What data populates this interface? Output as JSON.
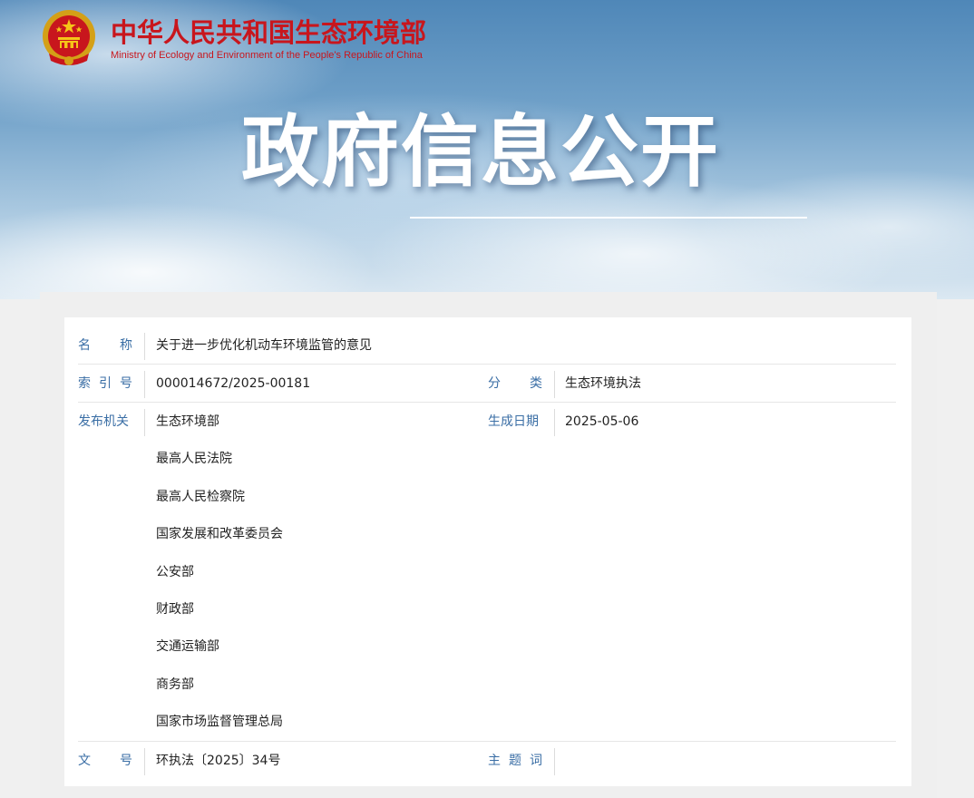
{
  "header": {
    "org_name_cn": "中华人民共和国生态环境部",
    "org_name_en": "Ministry of Ecology and Environment of the People's Republic of China",
    "emblem_icon": "national-emblem-icon",
    "page_title": "政府信息公开"
  },
  "info": {
    "name_label": [
      "名",
      "称"
    ],
    "name_value": "关于进一步优化机动车环境监管的意见",
    "index_label": [
      "索",
      "引",
      "号"
    ],
    "index_value": "000014672/2025-00181",
    "category_label": [
      "分",
      "类"
    ],
    "category_value": "生态环境执法",
    "issuer_label": "发布机关",
    "issuers": [
      "生态环境部",
      "最高人民法院",
      "最高人民检察院",
      "国家发展和改革委员会",
      "公安部",
      "财政部",
      "交通运输部",
      "商务部",
      "国家市场监督管理总局"
    ],
    "date_label": "生成日期",
    "date_value": "2025-05-06",
    "doc_no_label": [
      "文",
      "号"
    ],
    "doc_no_value": "环执法〔2025〕34号",
    "topic_label": [
      "主",
      "题",
      "词"
    ],
    "topic_value": ""
  },
  "colors": {
    "brand_red": "#c8161d",
    "label_blue": "#3a6ea5"
  }
}
